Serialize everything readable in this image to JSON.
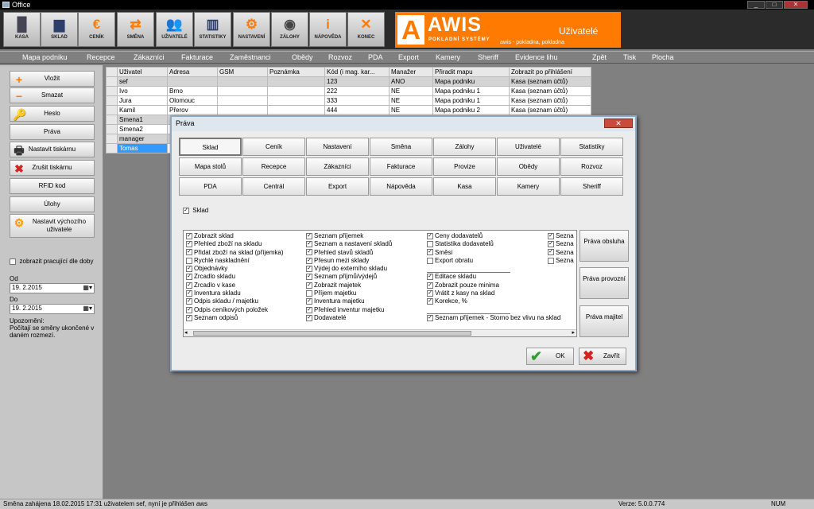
{
  "window": {
    "title": "Office"
  },
  "toolbar": [
    {
      "label": "KASA",
      "icon": "▐▌"
    },
    {
      "label": "SKLAD",
      "icon": "▆"
    },
    {
      "label": "CENÍK",
      "icon": "€"
    },
    {
      "label": "SMĚNA",
      "icon": "⇄"
    },
    {
      "label": "UŽIVATELÉ",
      "icon": "👥"
    },
    {
      "label": "STATISTIKY",
      "icon": "▥"
    },
    {
      "label": "NASTAVENÍ",
      "icon": "⚙"
    },
    {
      "label": "ZÁLOHY",
      "icon": "◉"
    },
    {
      "label": "NÁPOVĚDA",
      "icon": "i"
    },
    {
      "label": "KONEC",
      "icon": "✕"
    }
  ],
  "brand": {
    "name": "AWIS",
    "subtitle": "POKLADNÍ SYSTÉMY",
    "letter": "A",
    "section": "Uživatelé",
    "info": "awis - pokladna, pokladna"
  },
  "menu": [
    "Mapa podniku",
    "Recepce",
    "Zákazníci",
    "Fakturace",
    "Zaměstnanci",
    "Obědy",
    "Rozvoz",
    "PDA",
    "Export",
    "Kamery",
    "Sheriff",
    "Evidence lihu",
    "Zpět",
    "Tisk",
    "Plocha"
  ],
  "left_panel": {
    "buttons": [
      {
        "label": "Vložit",
        "icon": "+"
      },
      {
        "label": "Smazat",
        "icon": "−"
      },
      {
        "label": "Heslo",
        "icon": "🔑"
      },
      {
        "label": "Práva",
        "icon": ""
      },
      {
        "label": "Nastavit tiskárnu",
        "icon": "🖶"
      },
      {
        "label": "Zrušit tiskárnu",
        "icon": "✖"
      },
      {
        "label": "RFID kod",
        "icon": ""
      },
      {
        "label": "Úlohy",
        "icon": ""
      },
      {
        "label": "Nastavit výchozího uživatele",
        "icon": "⚙"
      }
    ],
    "checkbox_label": "zobrazit pracující dle doby",
    "od_label": "Od",
    "od_value": "19.  2.2015",
    "do_label": "Do",
    "do_value": "19.  2.2015",
    "warning": "Upozornění:\nPočítají se směny ukončené v daném rozmezí."
  },
  "grid": {
    "headers": [
      "Uživatel",
      "Adresa",
      "GSM",
      "Poznámka",
      "Kód (i mag. kar...",
      "Manažer",
      "Přiradit mapu",
      "Zobrazit po přihlášení"
    ],
    "rows": [
      [
        "sef",
        "",
        "",
        "",
        "123",
        "ANO",
        "Mapa podniku",
        "Kasa (seznam účtů)"
      ],
      [
        "Ivo",
        "Brno",
        "",
        "",
        "222",
        "NE",
        "Mapa podniku 1",
        "Kasa (seznam účtů)"
      ],
      [
        "Jura",
        "Olomouc",
        "",
        "",
        "333",
        "NE",
        "Mapa podniku 1",
        "Kasa (seznam účtů)"
      ],
      [
        "Kamil",
        "Přerov",
        "",
        "",
        "444",
        "NE",
        "Mapa podniku 2",
        "Kasa (seznam účtů)"
      ],
      [
        "Smena1",
        "",
        "",
        "",
        "",
        "",
        "",
        ""
      ],
      [
        "Smena2",
        "",
        "",
        "",
        "",
        "",
        "",
        ""
      ],
      [
        "manager",
        "",
        "",
        "",
        "",
        "",
        "",
        ""
      ],
      [
        "Tomas",
        "",
        "",
        "",
        "",
        "",
        "",
        ""
      ]
    ],
    "selected_row": 7,
    "gray_rows": [
      0,
      4,
      6
    ]
  },
  "dialog": {
    "title": "Práva",
    "close": "✕",
    "tabs": [
      "Sklad",
      "Ceník",
      "Nastavení",
      "Směna",
      "Zálohy",
      "Uživatelé",
      "Statistiky",
      "Mapa stolů",
      "Recepce",
      "Zákazníci",
      "Fakturace",
      "Provize",
      "Obědy",
      "Rozvoz",
      "PDA",
      "Centrál",
      "Export",
      "Nápověda",
      "Kasa",
      "Kamery",
      "Sheriff"
    ],
    "selected_tab": 0,
    "master_checkbox": "Sklad",
    "columns": [
      [
        {
          "label": "Zobrazit sklad",
          "checked": true
        },
        {
          "label": "Přehled zboží na skladu",
          "checked": true
        },
        {
          "label": "Přidat zboží na sklad (příjemka)",
          "checked": true
        },
        {
          "label": "Rychlé naskladnění",
          "checked": false
        },
        {
          "label": "Objednávky",
          "checked": true
        },
        {
          "label": "Zrcadlo skladu",
          "checked": true
        },
        {
          "label": "Zrcadlo v kase",
          "checked": true
        },
        {
          "label": "Inventura skladu",
          "checked": true
        },
        {
          "label": "Odpis skladu / majetku",
          "checked": true
        },
        {
          "label": "Odpis ceníkových položek",
          "checked": true
        },
        {
          "label": "Seznam odpisů",
          "checked": true
        }
      ],
      [
        {
          "label": "Seznam příjemek",
          "checked": true
        },
        {
          "label": "Seznam a nastavení skladů",
          "checked": true
        },
        {
          "label": "Přehled stavů skladů",
          "checked": true
        },
        {
          "label": "Přesun mezi sklady",
          "checked": true
        },
        {
          "label": "Výdej do externího skladu",
          "checked": true
        },
        {
          "label": "Seznam příjmů/výdejů",
          "checked": true
        },
        {
          "label": "Zobrazit majetek",
          "checked": true
        },
        {
          "label": "Příjem majetku",
          "checked": false
        },
        {
          "label": "Inventura majetku",
          "checked": true
        },
        {
          "label": "Přehled inventur majetku",
          "checked": true
        },
        {
          "label": "Dodavatelé",
          "checked": true
        }
      ],
      [
        {
          "label": "Ceny dodavatelů",
          "checked": true
        },
        {
          "label": "Statistika dodavatelů",
          "checked": false
        },
        {
          "label": "Směsi",
          "checked": true
        },
        {
          "label": "Export obratu",
          "checked": false
        },
        {
          "label": "",
          "checked": false,
          "separator": true
        },
        {
          "label": "Editace skladu",
          "checked": true
        },
        {
          "label": "Zobrazit pouze minima",
          "checked": true
        },
        {
          "label": "Vrátit z kasy na sklad",
          "checked": true
        },
        {
          "label": "Korekce, %",
          "checked": true
        },
        {
          "label": "",
          "checked": false,
          "separator": true
        },
        {
          "label": "Seznam příjemek - Storno bez vlivu na sklad",
          "checked": true
        }
      ],
      [
        {
          "label": "Sezna",
          "checked": true
        },
        {
          "label": "Sezna",
          "checked": true
        },
        {
          "label": "Sezna",
          "checked": true
        },
        {
          "label": "Sezna",
          "checked": false
        }
      ]
    ],
    "side_buttons": [
      "Práva obsluha",
      "Práva provozní",
      "Práva majitel"
    ],
    "ok": "OK",
    "cancel": "Zavřít"
  },
  "status": {
    "left": "Směna zahájena 18.02.2015 17:31 uživatelem sef, nyní je přihlášen aws",
    "version": "Verze: 5.0.0.774",
    "num": "NUM"
  },
  "colors": {
    "accent": "#ff7a00",
    "selected_row": "#3399ff",
    "check_green": "#2fa02f",
    "cancel_red": "#d82020"
  }
}
